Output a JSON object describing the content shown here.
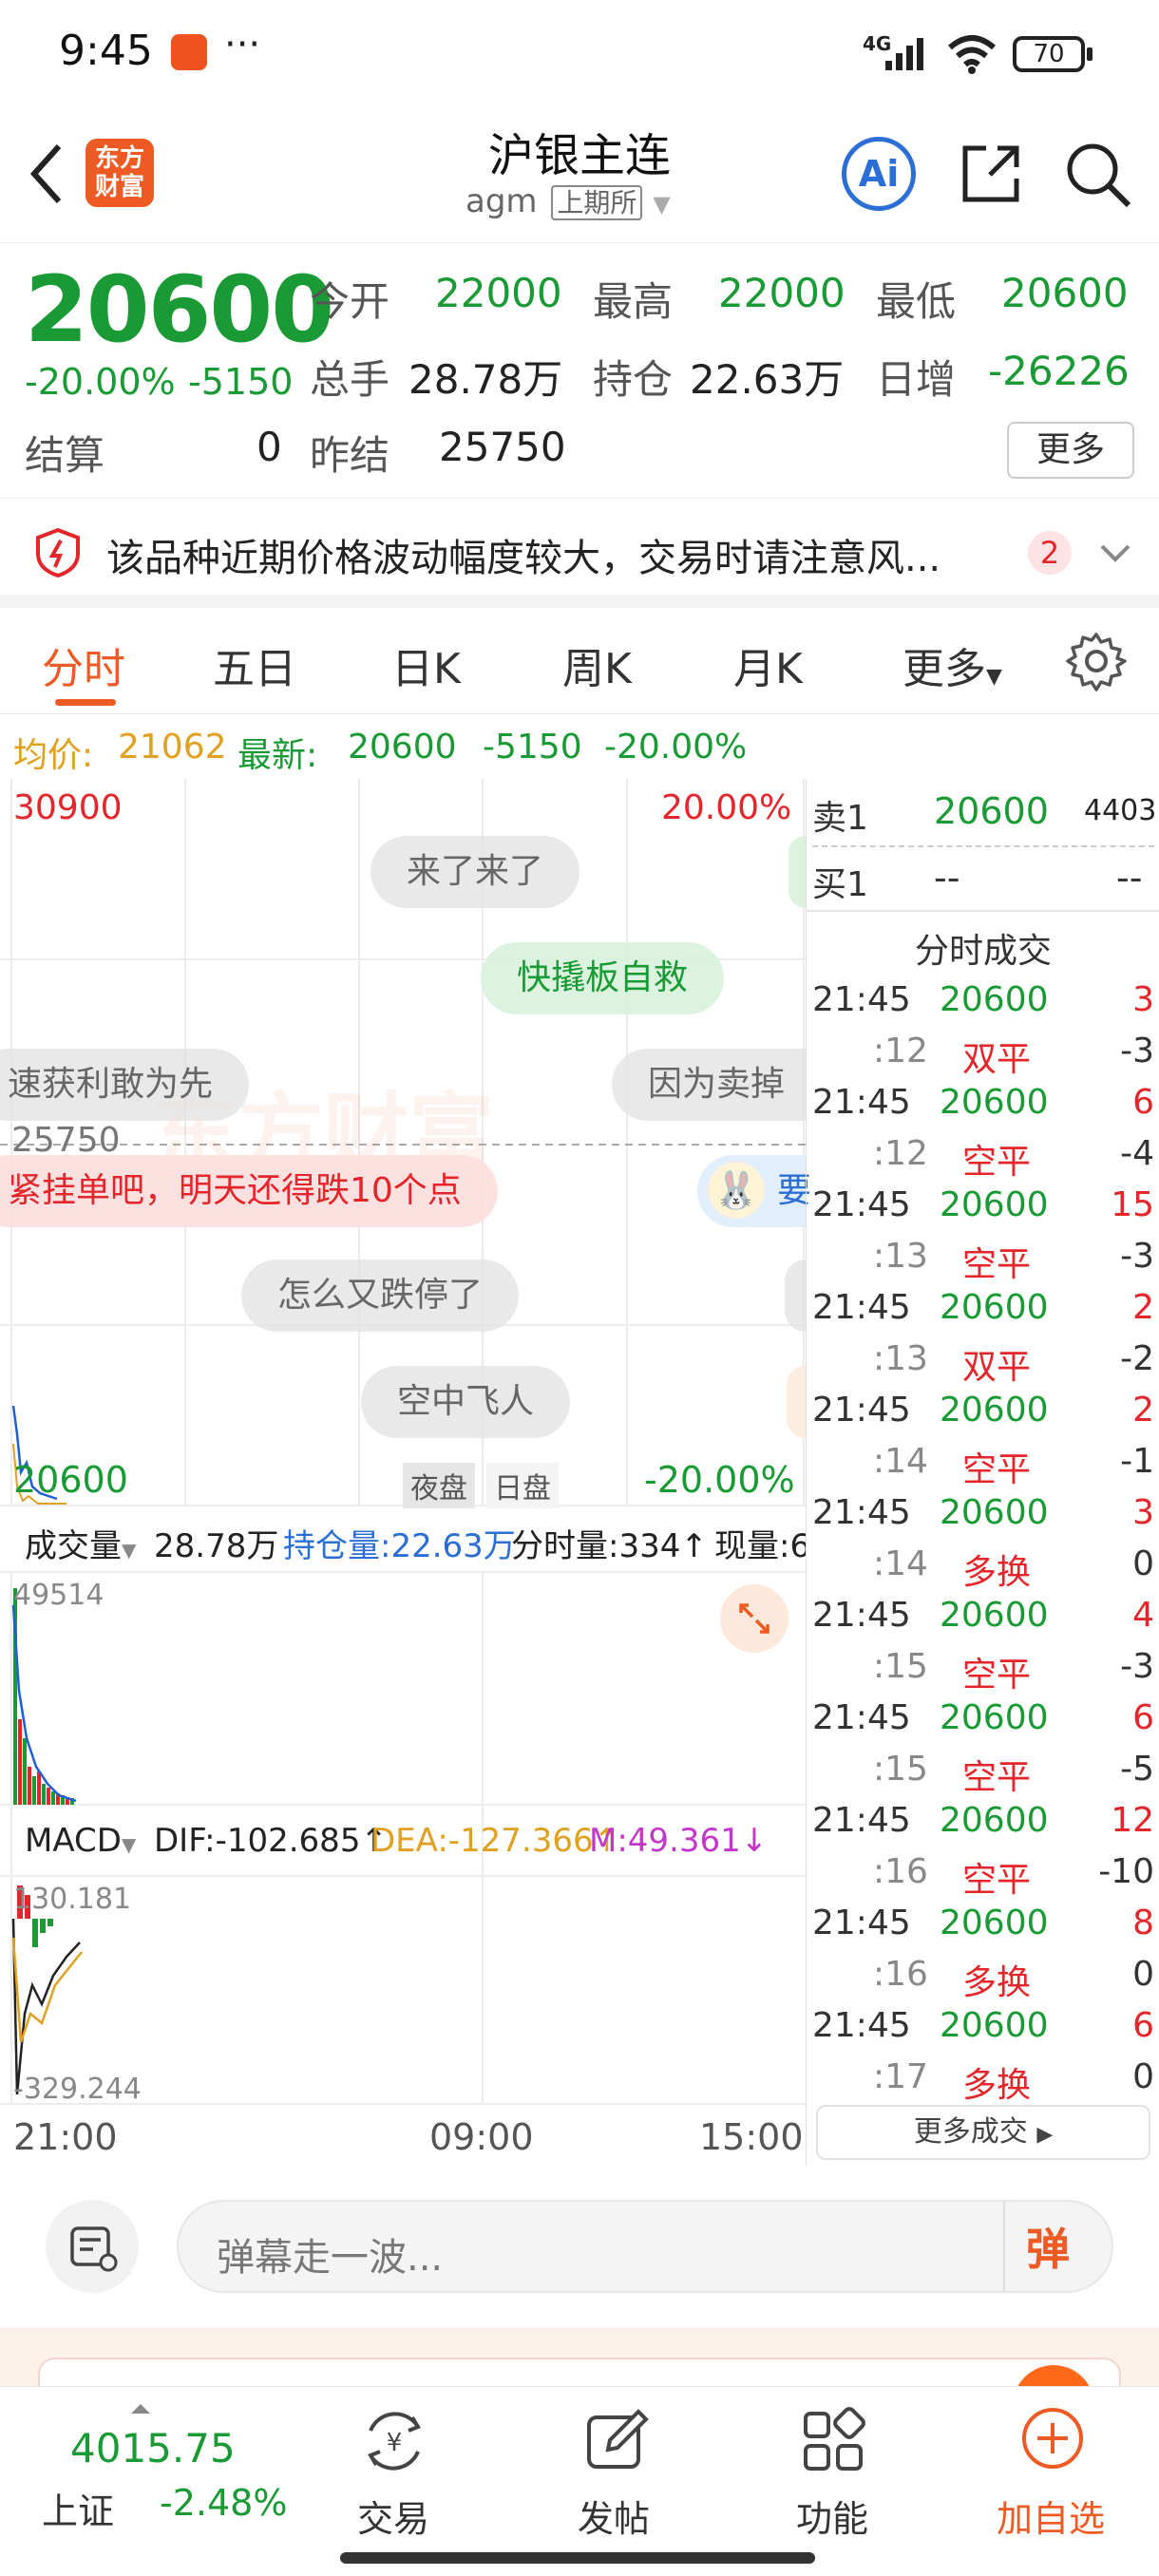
{
  "status": {
    "time": "9:45",
    "dots": "···",
    "network": "4G",
    "battery": "70"
  },
  "nav": {
    "title": "沪银主连",
    "code": "agm",
    "exchange": "上期所",
    "logo_top": "东方",
    "logo_bottom": "财富",
    "ai": "Ai"
  },
  "quote": {
    "price": "20600",
    "pct": "-20.00%",
    "chg": "-5150",
    "open_label": "今开",
    "open": "22000",
    "high_label": "最高",
    "high": "22000",
    "low_label": "最低",
    "low": "20600",
    "vol_label": "总手",
    "vol": "28.78万",
    "oi_label": "持仓",
    "oi": "22.63万",
    "inc_label": "日增",
    "inc": "-26226",
    "settle_label": "结算",
    "settle": "0",
    "prev_label": "昨结",
    "prev": "25750",
    "more": "更多"
  },
  "warning": {
    "text": "该品种近期价格波动幅度较大，交易时请注意风...",
    "count": "2"
  },
  "tabs": [
    "分时",
    "五日",
    "日K",
    "周K",
    "月K",
    "更多"
  ],
  "info": {
    "avg_label": "均价:",
    "avg": "21062",
    "last_label": "最新:",
    "last": "20600",
    "chg": "-5150",
    "pct": "-20.00%"
  },
  "chart": {
    "top_price": "30900",
    "top_pct": "20.00%",
    "mid_price": "25750",
    "bottom_price": "20600",
    "bottom_pct": "-20.00%",
    "session_night": "夜盘",
    "session_day": "日盘",
    "vol_label": "成交量",
    "vol": "28.78万",
    "oi_text": "持仓量:22.63万",
    "tick_text": "分时量:334↑",
    "cur_text": "现量:6",
    "vol_max": "49514",
    "macd_label": "MACD",
    "dif": "DIF:-102.685↑",
    "dea": "DEA:-127.366↑",
    "m": "M:49.361↓",
    "macd_max": "130.181",
    "macd_min": "-329.244",
    "x_labels": [
      "21:00",
      "09:00",
      "15:00"
    ]
  },
  "danmu": [
    "来了来了",
    "快撬板自救",
    "速获利敢为先",
    "因为卖掉",
    "紧挂单吧，明天还得跌10个点",
    "要",
    "怎么又跌停了",
    "空中飞人"
  ],
  "orderbook": {
    "sell_label": "卖1",
    "sell_price": "20600",
    "sell_vol": "4403",
    "buy_label": "买1",
    "buy_price": "--",
    "buy_vol": "--"
  },
  "ticks_title": "分时成交",
  "ticks": [
    {
      "a": "21:45",
      "b": "20600",
      "c": "3",
      "bc": "green",
      "cc": "red"
    },
    {
      "a": ":12",
      "b": "双平",
      "c": "-3",
      "bc": "red",
      "cc": "gray"
    },
    {
      "a": "21:45",
      "b": "20600",
      "c": "6",
      "bc": "green",
      "cc": "red"
    },
    {
      "a": ":12",
      "b": "空平",
      "c": "-4",
      "bc": "red",
      "cc": "gray"
    },
    {
      "a": "21:45",
      "b": "20600",
      "c": "15",
      "bc": "green",
      "cc": "red"
    },
    {
      "a": ":13",
      "b": "空平",
      "c": "-3",
      "bc": "red",
      "cc": "gray"
    },
    {
      "a": "21:45",
      "b": "20600",
      "c": "2",
      "bc": "green",
      "cc": "red"
    },
    {
      "a": ":13",
      "b": "双平",
      "c": "-2",
      "bc": "red",
      "cc": "gray"
    },
    {
      "a": "21:45",
      "b": "20600",
      "c": "2",
      "bc": "green",
      "cc": "red"
    },
    {
      "a": ":14",
      "b": "空平",
      "c": "-1",
      "bc": "red",
      "cc": "gray"
    },
    {
      "a": "21:45",
      "b": "20600",
      "c": "3",
      "bc": "green",
      "cc": "red"
    },
    {
      "a": ":14",
      "b": "多换",
      "c": "0",
      "bc": "red",
      "cc": "gray"
    },
    {
      "a": "21:45",
      "b": "20600",
      "c": "4",
      "bc": "green",
      "cc": "red"
    },
    {
      "a": ":15",
      "b": "空平",
      "c": "-3",
      "bc": "red",
      "cc": "gray"
    },
    {
      "a": "21:45",
      "b": "20600",
      "c": "6",
      "bc": "green",
      "cc": "red"
    },
    {
      "a": ":15",
      "b": "空平",
      "c": "-5",
      "bc": "red",
      "cc": "gray"
    },
    {
      "a": "21:45",
      "b": "20600",
      "c": "12",
      "bc": "green",
      "cc": "red"
    },
    {
      "a": ":16",
      "b": "空平",
      "c": "-10",
      "bc": "red",
      "cc": "gray"
    },
    {
      "a": "21:45",
      "b": "20600",
      "c": "8",
      "bc": "green",
      "cc": "red"
    },
    {
      "a": ":16",
      "b": "多换",
      "c": "0",
      "bc": "red",
      "cc": "gray"
    },
    {
      "a": "21:45",
      "b": "20600",
      "c": "6",
      "bc": "green",
      "cc": "red"
    },
    {
      "a": ":17",
      "b": "多换",
      "c": "0",
      "bc": "red",
      "cc": "gray"
    }
  ],
  "more_ticks": "更多成交",
  "comment": {
    "placeholder": "弹幕走一波...",
    "danmu_btn": "弹"
  },
  "tabbar": {
    "index_value": "4015.75",
    "index_name": "上证",
    "index_pct": "-2.48%",
    "trade": "交易",
    "post": "发帖",
    "func": "功能",
    "add": "加自选"
  },
  "colors": {
    "up": "#e4262b",
    "down": "#1a9a35",
    "accent": "#ff6a00"
  }
}
